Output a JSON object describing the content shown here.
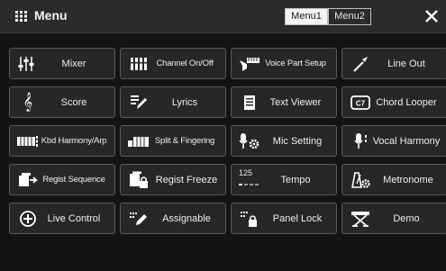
{
  "header": {
    "title": "Menu",
    "tabs": [
      {
        "label": "Menu1",
        "active": true
      },
      {
        "label": "Menu2",
        "active": false
      }
    ]
  },
  "buttons": [
    {
      "label": "Mixer",
      "icon": "mixer-sliders-icon"
    },
    {
      "label": "Channel On/Off",
      "icon": "channel-onoff-icon"
    },
    {
      "label": "Voice Part Setup",
      "icon": "voice-part-setup-icon"
    },
    {
      "label": "Line Out",
      "icon": "line-out-jack-icon"
    },
    {
      "label": "Score",
      "icon": "treble-clef-icon"
    },
    {
      "label": "Lyrics",
      "icon": "lyrics-pen-icon"
    },
    {
      "label": "Text Viewer",
      "icon": "text-document-icon"
    },
    {
      "label": "Chord Looper",
      "icon": "chord-looper-icon"
    },
    {
      "label": "Kbd Harmony/Arp",
      "icon": "keyboard-harmony-icon"
    },
    {
      "label": "Split & Fingering",
      "icon": "split-keyboard-icon"
    },
    {
      "label": "Mic Setting",
      "icon": "mic-gear-icon"
    },
    {
      "label": "Vocal Harmony",
      "icon": "vocal-harmony-mic-icon"
    },
    {
      "label": "Regist Sequence",
      "icon": "registration-sequence-icon"
    },
    {
      "label": "Regist Freeze",
      "icon": "registration-freeze-lock-icon"
    },
    {
      "label": "Tempo",
      "icon": "tempo-display-icon",
      "value": "125"
    },
    {
      "label": "Metronome",
      "icon": "metronome-icon"
    },
    {
      "label": "Live Control",
      "icon": "live-control-plus-icon"
    },
    {
      "label": "Assignable",
      "icon": "assignable-pen-icon"
    },
    {
      "label": "Panel Lock",
      "icon": "panel-lock-icon"
    },
    {
      "label": "Demo",
      "icon": "demo-keyboard-stand-icon"
    }
  ],
  "colors": {
    "background": "#141414",
    "header": "#2b2b2b",
    "button": "#272727",
    "button_border": "#5a5a5a",
    "text": "#eeeeee"
  }
}
